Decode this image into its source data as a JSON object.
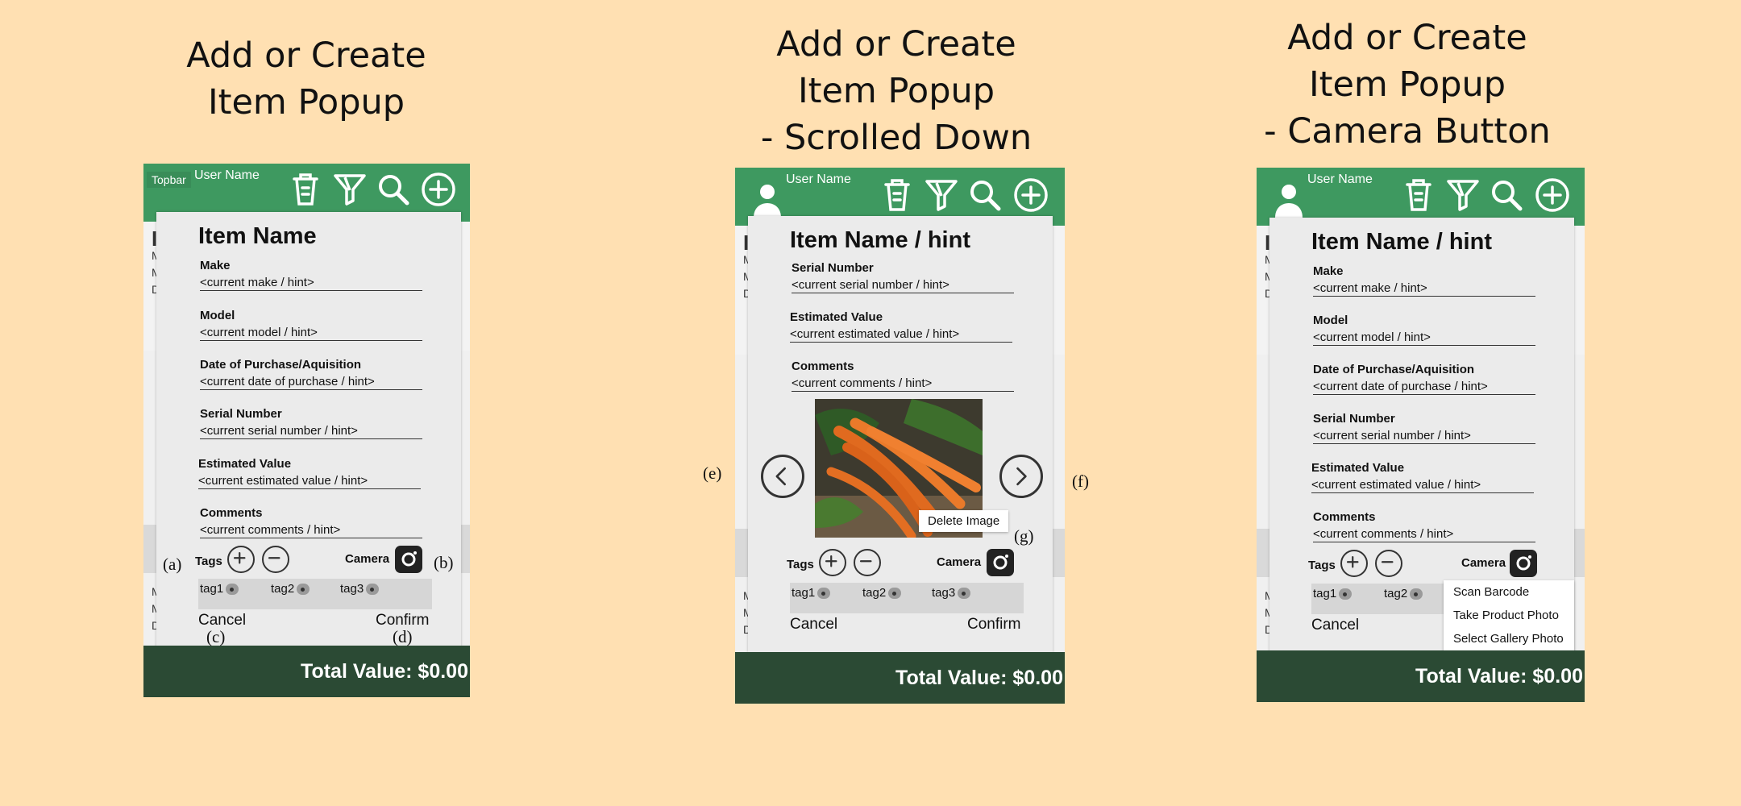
{
  "screens": [
    {
      "title_lines": [
        "Add or Create",
        "Item Popup"
      ],
      "topbar": {
        "user_name": "User Name",
        "tag": "Topbar"
      },
      "popup": {
        "title": "Item Name",
        "fields": [
          {
            "label": "Make",
            "value": "<current make / hint>"
          },
          {
            "label": "Model",
            "value": "<current model / hint>"
          },
          {
            "label": "Date of Purchase/Aquisition",
            "value": "<current date of purchase / hint>"
          },
          {
            "label": "Serial Number",
            "value": "<current serial number / hint>"
          },
          {
            "label": "Estimated Value",
            "value": "<current estimated value / hint>"
          },
          {
            "label": "Comments",
            "value": "<current comments / hint>"
          }
        ],
        "tags_label": "Tags",
        "camera_label": "Camera",
        "tags": [
          "tag1",
          "tag2",
          "tag3"
        ],
        "cancel": "Cancel",
        "confirm": "Confirm"
      },
      "bg_letters": [
        "I",
        "M",
        "M",
        "D",
        "M",
        "M",
        "D"
      ],
      "total": "Total Value: $0.00",
      "annotations": {
        "a": "(a)",
        "b": "(b)",
        "c": "(c)",
        "d": "(d)"
      }
    },
    {
      "title_lines": [
        "Add or Create",
        "Item Popup",
        "- Scrolled Down"
      ],
      "topbar": {
        "user_name": "User Name"
      },
      "popup": {
        "title": "Item Name / hint",
        "fields": [
          {
            "label": "Serial Number",
            "value": "<current serial number / hint>"
          },
          {
            "label": "Estimated Value",
            "value": "<current estimated value / hint>"
          },
          {
            "label": "Comments",
            "value": "<current comments / hint>"
          }
        ],
        "delete_image": "Delete Image",
        "tags_label": "Tags",
        "camera_label": "Camera",
        "tags": [
          "tag1",
          "tag2",
          "tag3"
        ],
        "cancel": "Cancel",
        "confirm": "Confirm"
      },
      "bg_letters": [
        "I",
        "M",
        "M",
        "D",
        "M",
        "M",
        "D"
      ],
      "total": "Total Value: $0.00",
      "annotations": {
        "e": "(e)",
        "f": "(f)",
        "g": "(g)"
      }
    },
    {
      "title_lines": [
        "Add or Create",
        "Item Popup",
        "- Camera Button"
      ],
      "topbar": {
        "user_name": "User Name"
      },
      "popup": {
        "title": "Item Name / hint",
        "fields": [
          {
            "label": "Make",
            "value": "<current make / hint>"
          },
          {
            "label": "Model",
            "value": "<current model / hint>"
          },
          {
            "label": "Date of Purchase/Aquisition",
            "value": "<current date of purchase / hint>"
          },
          {
            "label": "Serial Number",
            "value": "<current serial number / hint>"
          },
          {
            "label": "Estimated Value",
            "value": "<current estimated value / hint>"
          },
          {
            "label": "Comments",
            "value": "<current comments / hint>"
          }
        ],
        "tags_label": "Tags",
        "camera_label": "Camera",
        "tags": [
          "tag1",
          "tag2"
        ],
        "cancel": "Cancel",
        "camera_menu": [
          "Scan Barcode",
          "Take Product Photo",
          "Select Gallery Photo"
        ]
      },
      "bg_letters": [
        "I",
        "M",
        "M",
        "D",
        "M",
        "M",
        "D"
      ],
      "total": "Total Value: $0.00"
    }
  ],
  "colors": {
    "background": "#ffe0b2",
    "topbar": "#3e9960",
    "bottombar": "#2b4a34",
    "popup": "#ebebeb"
  },
  "icons": [
    "person-icon",
    "trash-icon",
    "filter-icon",
    "search-icon",
    "add-circle-icon",
    "plus-icon",
    "minus-icon",
    "camera-icon",
    "chevron-left-icon",
    "chevron-right-icon",
    "carrots-photo"
  ]
}
